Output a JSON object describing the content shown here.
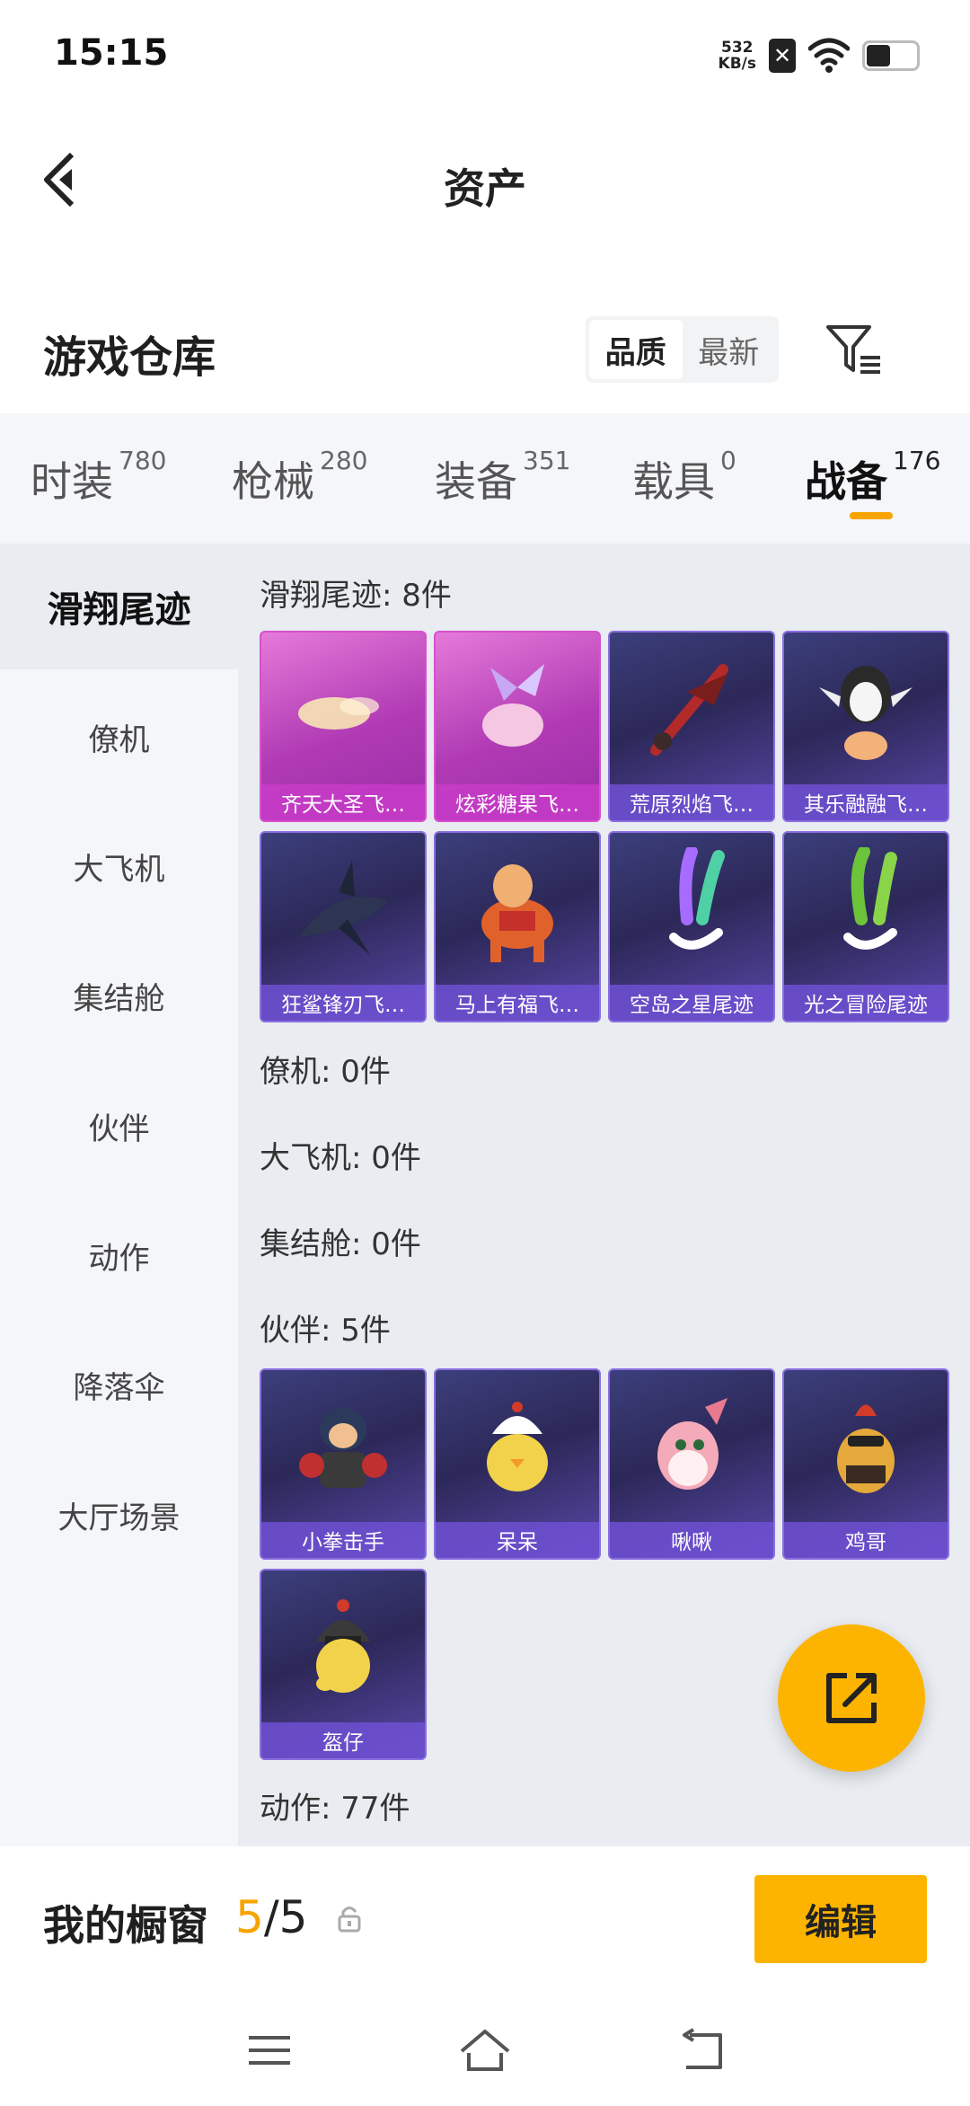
{
  "status_bar": {
    "time": "15:15",
    "net_speed_value": "532",
    "net_speed_unit": "KB/s",
    "sim_label": "✕",
    "icons": [
      "sim-off-icon",
      "wifi-icon",
      "battery-icon"
    ]
  },
  "header": {
    "title": "资产",
    "back_icon": "chevron-left-icon"
  },
  "warehouse": {
    "title": "游戏仓库",
    "sort_options": [
      "品质",
      "最新"
    ],
    "sort_selected": "品质",
    "filter_icon": "filter-icon"
  },
  "category_tabs": [
    {
      "label": "时装",
      "count": "780"
    },
    {
      "label": "枪械",
      "count": "280"
    },
    {
      "label": "装备",
      "count": "351"
    },
    {
      "label": "载具",
      "count": "0"
    },
    {
      "label": "战备",
      "count": "176"
    }
  ],
  "active_category": "战备",
  "sidebar": {
    "items": [
      "滑翔尾迹",
      "僚机",
      "大飞机",
      "集结舱",
      "伙伴",
      "动作",
      "降落伞",
      "大厅场景"
    ],
    "active": "滑翔尾迹"
  },
  "sections": [
    {
      "title": "滑翔尾迹: 8件",
      "items": [
        {
          "name": "齐天大圣飞…",
          "rarity": "pink"
        },
        {
          "name": "炫彩糖果飞…",
          "rarity": "pink"
        },
        {
          "name": "荒原烈焰飞…",
          "rarity": "purple"
        },
        {
          "name": "其乐融融飞…",
          "rarity": "purple"
        },
        {
          "name": "狂鲨锋刃飞…",
          "rarity": "purple"
        },
        {
          "name": "马上有福飞…",
          "rarity": "purple"
        },
        {
          "name": "空岛之星尾迹",
          "rarity": "purple"
        },
        {
          "name": "光之冒险尾迹",
          "rarity": "purple"
        }
      ]
    },
    {
      "title": "僚机: 0件",
      "items": []
    },
    {
      "title": "大飞机: 0件",
      "items": []
    },
    {
      "title": "集结舱: 0件",
      "items": []
    },
    {
      "title": "伙伴: 5件",
      "items": [
        {
          "name": "小拳击手",
          "rarity": "purple"
        },
        {
          "name": "呆呆",
          "rarity": "purple"
        },
        {
          "name": "啾啾",
          "rarity": "purple"
        },
        {
          "name": "鸡哥",
          "rarity": "purple"
        },
        {
          "name": "盔仔",
          "rarity": "purple"
        }
      ]
    },
    {
      "title": "动作: 77件",
      "items": []
    }
  ],
  "share_button": {
    "icon": "share-icon"
  },
  "showcase": {
    "label": "我的橱窗",
    "current": "5",
    "total": "/5",
    "lock_icon": "lock-icon",
    "edit_label": "编辑"
  },
  "nav_bar": {
    "icons": [
      "menu-icon",
      "home-icon",
      "back-icon"
    ]
  },
  "colors": {
    "accent": "#fcb400",
    "tab_underline": "#f7a300",
    "card_purple": "#3c3f7c",
    "card_pink": "#b03ab4",
    "content_bg": "#e9ecf0",
    "sidebar_bg": "#f4f6f9"
  }
}
